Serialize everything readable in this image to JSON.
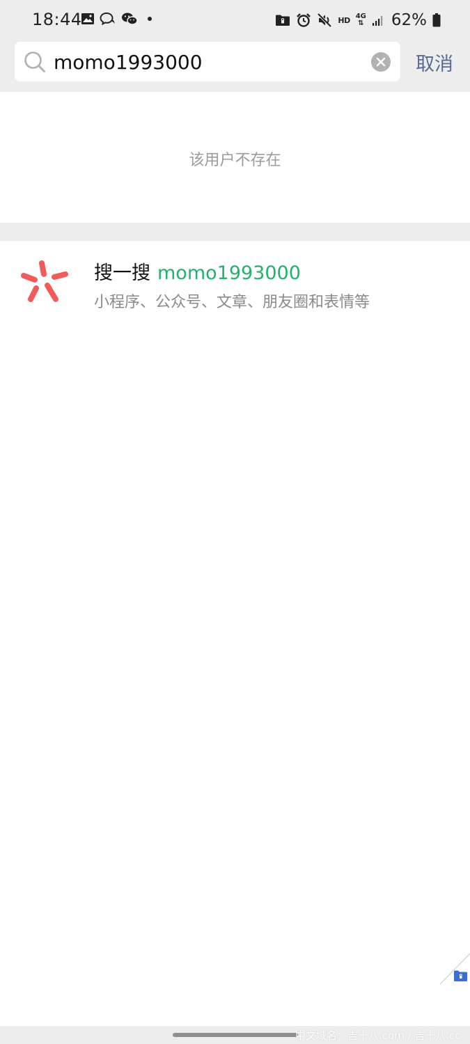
{
  "status_bar": {
    "time": "18:44",
    "hd_label": "HD",
    "network_label": "4G",
    "battery": "62%"
  },
  "search": {
    "query": "momo1993000",
    "cancel_label": "取消"
  },
  "result": {
    "no_user_text": "该用户不存在"
  },
  "sousou": {
    "title": "搜一搜",
    "keyword": "momo1993000",
    "subtitle": "小程序、公众号、文章、朋友圈和表情等"
  },
  "watermark": "中文域名：吉十八.com / 吉十八.cc",
  "colors": {
    "accent_link": "#576b95",
    "keyword_green": "#20b36b",
    "sousou_red": "#f25b5b",
    "header_gray": "#ededed"
  },
  "icons": {
    "search": "magnifier-icon",
    "clear": "clear-circle-icon",
    "sousou": "sousou-logo-icon"
  }
}
